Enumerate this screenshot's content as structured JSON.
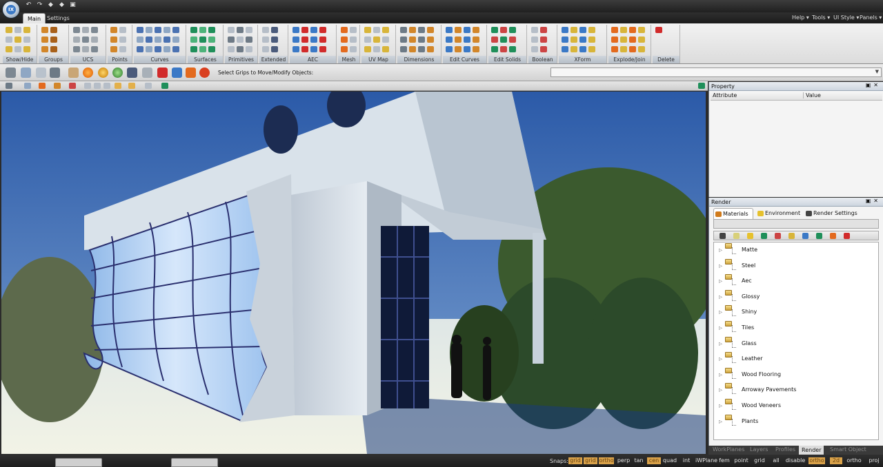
{
  "app": {
    "logo_text": "IX"
  },
  "menu": {
    "tabs": [
      "Main",
      "Settings"
    ],
    "right": [
      "Help ▾",
      "Tools ▾",
      "UI Style ▾",
      "Panels ▾"
    ]
  },
  "ribbon": {
    "groups": [
      "Show/Hide",
      "Groups",
      "UCS",
      "Points",
      "Curves",
      "Surfaces",
      "Primitives",
      "Extended",
      "AEC",
      "Mesh",
      "UV Map",
      "Dimensions",
      "Edit Curves",
      "Edit Solids",
      "Boolean",
      "XForm",
      "Explode/Join",
      "Delete"
    ]
  },
  "toolbar": {
    "status_text": "Select Grips to Move/Modify Objects:"
  },
  "property_panel": {
    "title": "Property",
    "columns": [
      "Attribute",
      "Value"
    ]
  },
  "render_panel": {
    "title": "Render",
    "tabs": [
      "Materials",
      "Environment",
      "Render Settings"
    ],
    "materials": [
      "Matte",
      "Steel",
      "Aec",
      "Glossy",
      "Shiny",
      "Tiles",
      "Glass",
      "Leather",
      "Wood Flooring",
      "Arroway Pavements",
      "Wood Veneers",
      "Plants"
    ]
  },
  "bottom_tabs": [
    "WorkPlanes",
    "Layers",
    "Profiles",
    "Render",
    "Smart Object"
  ],
  "status": {
    "snaps_label": "Snaps:",
    "snaps": [
      {
        "label": "grid",
        "on": true
      },
      {
        "label": "grid",
        "on": true
      },
      {
        "label": "ortho",
        "on": true
      },
      {
        "label": "perp",
        "on": false
      },
      {
        "label": "tan",
        "on": false
      },
      {
        "label": "cen",
        "on": true
      },
      {
        "label": "quad",
        "on": false
      },
      {
        "label": "int",
        "on": false
      },
      {
        "label": "iWPlane",
        "on": false
      },
      {
        "label": "fem",
        "on": false
      },
      {
        "label": "point",
        "on": false
      },
      {
        "label": "grid",
        "on": false
      },
      {
        "label": "all",
        "on": false
      },
      {
        "label": "disable",
        "on": false
      },
      {
        "label": "ortho",
        "on": true
      },
      {
        "label": "2d",
        "on": true
      },
      {
        "label": "ortho",
        "on": false
      },
      {
        "label": "proj",
        "on": false
      }
    ]
  },
  "colors": {
    "accent": "#3b79c6",
    "ribbon_label": "#b6bec8",
    "snap_on": "#d9a24a"
  }
}
